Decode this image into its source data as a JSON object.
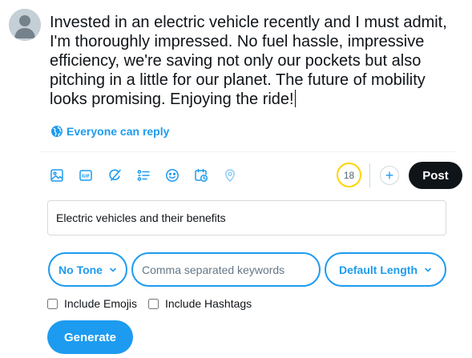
{
  "compose": {
    "text": "Invested in an electric vehicle recently and I must admit, I'm thoroughly impressed. No fuel hassle, impressive efficiency, we're saving not only our pockets but also pitching in a little for our planet. The future of mobility looks promising. Enjoying the ride!",
    "reply_setting": "Everyone can reply",
    "reply_icon": "globe-icon"
  },
  "toolbar": {
    "icons": [
      "image-icon",
      "gif-icon",
      "grok-icon",
      "poll-icon",
      "emoji-icon",
      "schedule-icon",
      "location-icon"
    ],
    "char_remaining": "18",
    "add_icon": "plus-icon",
    "post_label": "Post"
  },
  "generator": {
    "topic_value": "Electric vehicles and their benefits",
    "tone_label": "No Tone",
    "keywords_placeholder": "Comma separated keywords",
    "keywords_value": "",
    "length_label": "Default Length",
    "include_emojis_label": "Include Emojis",
    "include_hashtags_label": "Include Hashtags",
    "generate_label": "Generate"
  },
  "colors": {
    "accent": "#1d9bf0",
    "post_button": "#0f1419",
    "counter_ring": "#ffd400"
  }
}
